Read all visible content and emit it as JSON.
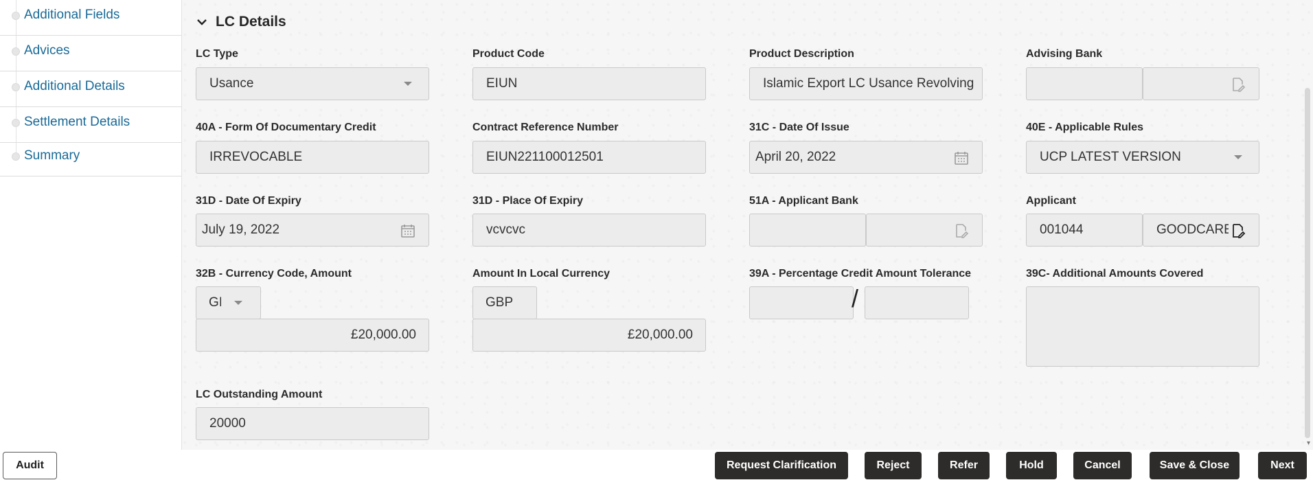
{
  "sidebar": {
    "items": [
      {
        "label": "Additional Fields"
      },
      {
        "label": "Advices"
      },
      {
        "label": "Additional Details"
      },
      {
        "label": "Settlement Details"
      },
      {
        "label": "Summary"
      }
    ]
  },
  "section": {
    "title": "LC Details"
  },
  "fields": {
    "lc_type": {
      "label": "LC Type",
      "value": "Usance"
    },
    "product_code": {
      "label": "Product Code",
      "value": "EIUN"
    },
    "product_description": {
      "label": "Product Description",
      "value": "Islamic Export LC Usance Revolving"
    },
    "advising_bank": {
      "label": "Advising Bank",
      "value1": "",
      "value2": ""
    },
    "form_of_credit": {
      "label": "40A - Form Of Documentary Credit",
      "value": "IRREVOCABLE"
    },
    "contract_ref": {
      "label": "Contract Reference Number",
      "value": "EIUN221100012501"
    },
    "date_of_issue": {
      "label": "31C - Date Of Issue",
      "value": "April 20, 2022"
    },
    "applicable_rules": {
      "label": "40E - Applicable Rules",
      "value": "UCP LATEST VERSION"
    },
    "date_of_expiry": {
      "label": "31D - Date Of Expiry",
      "value": "July 19, 2022"
    },
    "place_of_expiry": {
      "label": "31D - Place Of Expiry",
      "value": "vcvcvc"
    },
    "applicant_bank": {
      "label": "51A - Applicant Bank",
      "value1": "",
      "value2": ""
    },
    "applicant": {
      "label": "Applicant",
      "id": "001044",
      "name": "GOODCARE"
    },
    "currency_amount": {
      "label": "32B - Currency Code, Amount",
      "currency": "GBP",
      "currency_visible": "GI",
      "amount": "£20,000.00"
    },
    "local_amount": {
      "label": "Amount In Local Currency",
      "currency": "GBP",
      "amount": "£20,000.00"
    },
    "tolerance": {
      "label": "39A - Percentage Credit Amount Tolerance",
      "plus": "",
      "separator": "/",
      "minus": ""
    },
    "additional_amounts": {
      "label": "39C- Additional Amounts Covered",
      "value": ""
    },
    "outstanding": {
      "label": "LC Outstanding Amount",
      "value": "20000"
    }
  },
  "footer": {
    "audit": "Audit",
    "buttons": {
      "request_clarification": "Request Clarification",
      "reject": "Reject",
      "refer": "Refer",
      "hold": "Hold",
      "cancel": "Cancel",
      "save_close": "Save & Close",
      "next": "Next"
    }
  },
  "icons": {
    "chevron": "chevron-down-icon",
    "calendar": "calendar-icon",
    "lookup": "search-document-icon"
  },
  "colors": {
    "sidebar_link": "#1a6a96",
    "button_bg": "#2e2c2a",
    "field_bg": "#ececec"
  }
}
